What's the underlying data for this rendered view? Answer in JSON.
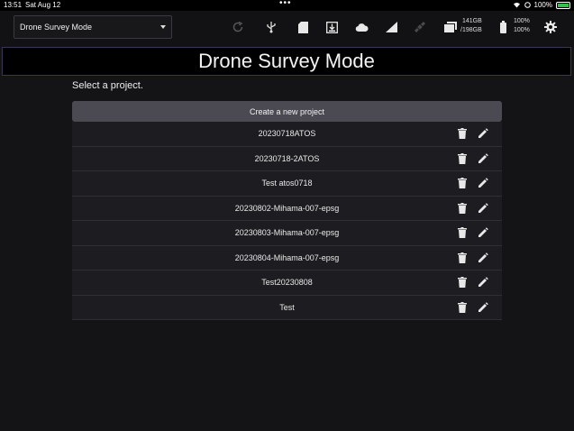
{
  "status_bar": {
    "time": "13:51",
    "date": "Sat Aug 12",
    "battery_percent": "100%"
  },
  "toolbar": {
    "mode_selected": "Drone Survey Mode",
    "storage_used": "141GB",
    "storage_total": "/198GB",
    "battery_1": "100%",
    "battery_2": "100%",
    "icons": [
      "refresh-icon",
      "usb-icon",
      "sd-card-icon",
      "download-icon",
      "cloud-icon",
      "signal-icon",
      "satellite-icon",
      "folder-icon",
      "battery-icon",
      "gear-icon"
    ]
  },
  "banner": {
    "title": "Drone Survey Mode"
  },
  "main": {
    "subtitle": "Select a project.",
    "create_label": "Create a new project",
    "projects": [
      "20230718ATOS",
      "20230718-2ATOS",
      "Test atos0718",
      "20230802-Mihama-007-epsg",
      "20230803-Mihama-007-epsg",
      "20230804-Mihama-007-epsg",
      "Test20230808",
      "Test"
    ]
  },
  "colors": {
    "background": "#141416",
    "button": "#4b4a53",
    "row": "#1d1d21",
    "battery_green": "#36c24a"
  }
}
